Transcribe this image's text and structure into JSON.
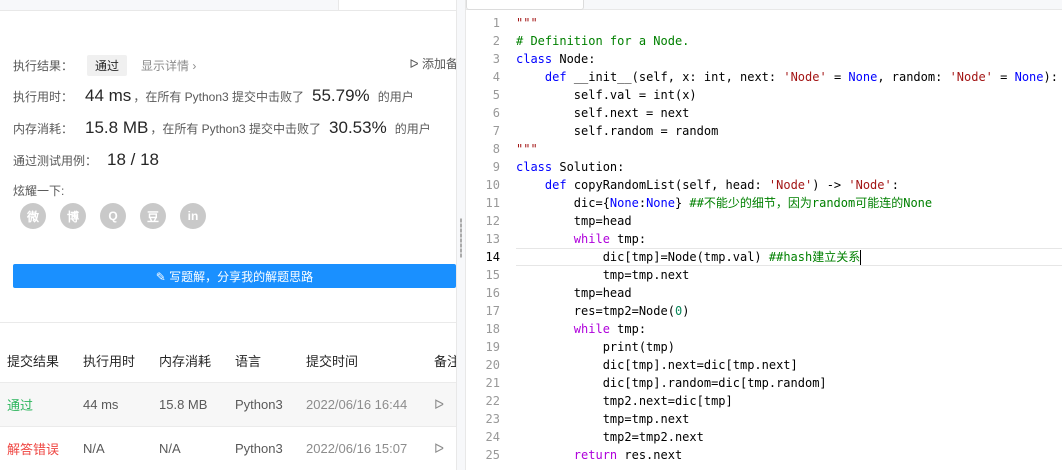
{
  "result": {
    "exec_label": "执行结果：",
    "status": "通过",
    "details_link": "显示详情 ›",
    "add_note": "添加备",
    "runtime_label": "执行用时：",
    "runtime_value": "44 ms",
    "runtime_text": "，在所有 Python3 提交中击败了",
    "runtime_pct": "55.79%",
    "runtime_suffix": "的用户",
    "memory_label": "内存消耗：",
    "memory_value": "15.8 MB",
    "memory_text": "，在所有 Python3 提交中击败了",
    "memory_pct": "30.53%",
    "memory_suffix": "的用户",
    "tests_label": "通过测试用例：",
    "tests_value": "18 / 18",
    "share_label": "炫耀一下:",
    "share_icons": [
      "wechat-icon",
      "weibo-icon",
      "qq-icon",
      "douban-icon",
      "linkedin-icon"
    ],
    "share_glyphs": [
      "微",
      "博",
      "Q",
      "豆",
      "in"
    ],
    "write_button": "✎ 写题解，分享我的解题思路"
  },
  "submissions": {
    "headers": [
      "提交结果",
      "执行用时",
      "内存消耗",
      "语言",
      "提交时间",
      "备注"
    ],
    "rows": [
      {
        "status": "通过",
        "time": "44 ms",
        "memory": "15.8 MB",
        "lang": "Python3",
        "date": "2022/06/16 16:44"
      },
      {
        "status": "解答错误",
        "time": "N/A",
        "memory": "N/A",
        "lang": "Python3",
        "date": "2022/06/16 15:07"
      }
    ]
  },
  "editor": {
    "current_line": 14,
    "lines": [
      "\"\"\"",
      "# Definition for a Node.",
      "class Node:",
      "    def __init__(self, x: int, next: 'Node' = None, random: 'Node' = None):",
      "        self.val = int(x)",
      "        self.next = next",
      "        self.random = random",
      "\"\"\"",
      "class Solution:",
      "    def copyRandomList(self, head: 'Node') -> 'Node':",
      "        dic={None:None} ##不能少的细节，因为random可能连的None",
      "        tmp=head",
      "        while tmp:",
      "            dic[tmp]=Node(tmp.val) ##hash建立关系",
      "            tmp=tmp.next",
      "        tmp=head",
      "        res=tmp2=Node(0)",
      "        while tmp:",
      "            print(tmp)",
      "            dic[tmp].next=dic[tmp.next]",
      "            dic[tmp].random=dic[tmp.random]",
      "            tmp2.next=dic[tmp]",
      "            tmp=tmp.next",
      "            tmp2=tmp2.next",
      "        return res.next"
    ]
  },
  "colors": {
    "accent": "#1a90ff",
    "success": "#2db55d",
    "error": "#ef4743"
  }
}
